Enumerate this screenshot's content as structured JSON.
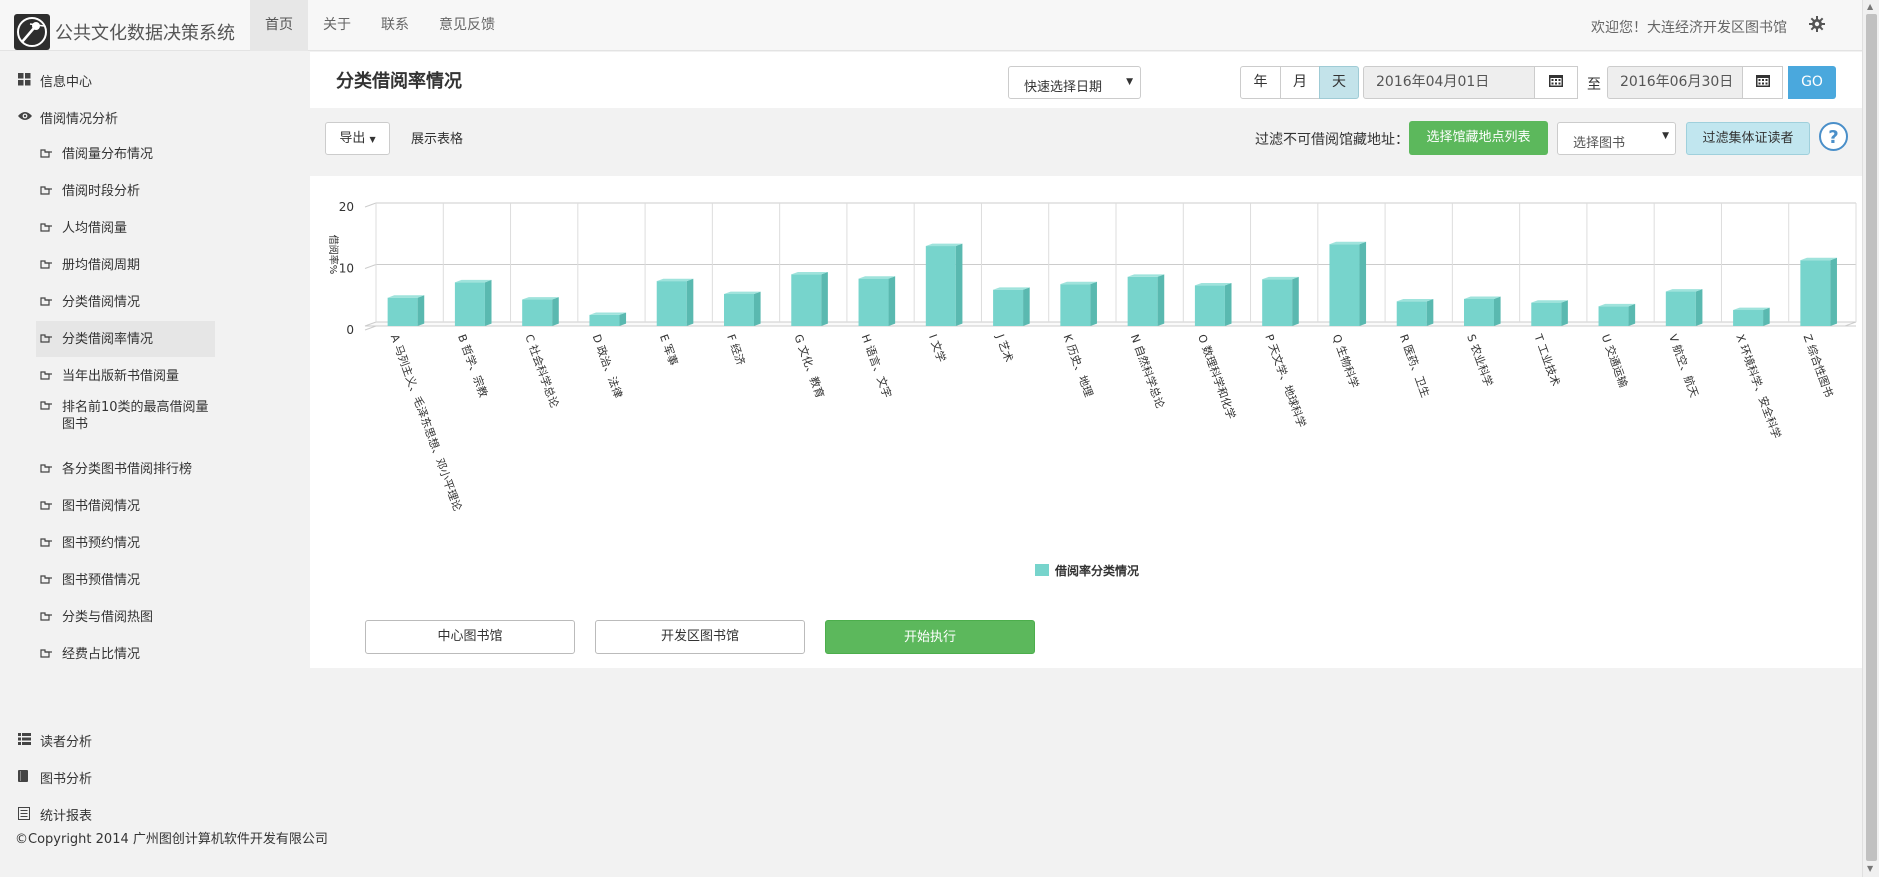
{
  "app": {
    "title": "公共文化数据决策系统",
    "welcome": "欢迎您！大连经济开发区图书馆"
  },
  "nav": [
    "首页",
    "关于",
    "联系",
    "意见反馈"
  ],
  "sidebar": {
    "top_items": [
      {
        "label": "信息中心",
        "icon": "dashboard-icon"
      },
      {
        "label": "借阅情况分析",
        "icon": "eye-icon"
      },
      {
        "label": "读者分析",
        "icon": "list-icon"
      },
      {
        "label": "图书分析",
        "icon": "book-icon"
      },
      {
        "label": "统计报表",
        "icon": "report-icon"
      }
    ],
    "sub_items": [
      "借阅量分布情况",
      "借阅时段分析",
      "人均借阅量",
      "册均借阅周期",
      "分类借阅情况",
      "分类借阅率情况",
      "当年出版新书借阅量",
      "排名前10类的最高借阅量图书",
      "各分类图书借阅排行榜",
      "图书借阅情况",
      "图书预约情况",
      "图书预借情况",
      "分类与借阅热图",
      "经费占比情况"
    ],
    "active_sub": "分类借阅率情况"
  },
  "header": {
    "title": "分类借阅率情况",
    "quick_date": "快速选择日期",
    "period": [
      "年",
      "月",
      "天"
    ],
    "period_active": "天",
    "start_date": "2016年04月01日",
    "to_label": "至",
    "end_date": "2016年06月30日",
    "go": "GO"
  },
  "toolbar": {
    "export": "导出",
    "show_table": "展示表格",
    "filter_label": "过滤不可借阅馆藏地址：",
    "choose_locations": "选择馆藏地点列表",
    "choose_book": "选择图书",
    "filter_group": "过滤集体证读者"
  },
  "chart_data": {
    "type": "bar",
    "ylabel": "借阅率%",
    "ylim": [
      0,
      20
    ],
    "yticks": [
      0,
      10,
      20
    ],
    "grid": true,
    "legend_position": "bottom-center",
    "series": [
      {
        "name": "借阅率分类情况",
        "color": "#77d4cc",
        "values": [
          4.6,
          7.1,
          4.3,
          1.8,
          7.3,
          5.2,
          8.4,
          7.7,
          13.0,
          5.9,
          6.8,
          8.0,
          6.6,
          7.6,
          13.3,
          4.0,
          4.4,
          3.8,
          3.2,
          5.6,
          2.6,
          10.7
        ]
      }
    ],
    "categories": [
      "A 马列主义、毛泽东思想、邓小平理论",
      "B 哲学、宗教",
      "C 社会科学总论",
      "D 政治、法律",
      "E 军事",
      "F 经济",
      "G 文化、教育",
      "H 语言、文字",
      "I 文学",
      "J 艺术",
      "K 历史、地理",
      "N 自然科学总论",
      "O 数理科学和化学",
      "P 天文学、地球科学",
      "Q 生物科学",
      "R 医药、卫生",
      "S 农业科学",
      "T 工业技术",
      "U 交通运输",
      "V 航空、航天",
      "X 环境科学、安全科学",
      "Z 综合性图书"
    ]
  },
  "actions": {
    "center_library": "中心图书馆",
    "dev_library": "开发区图书馆",
    "run": "开始执行"
  },
  "footer": "©Copyright 2014 广州图创计算机软件开发有限公司"
}
